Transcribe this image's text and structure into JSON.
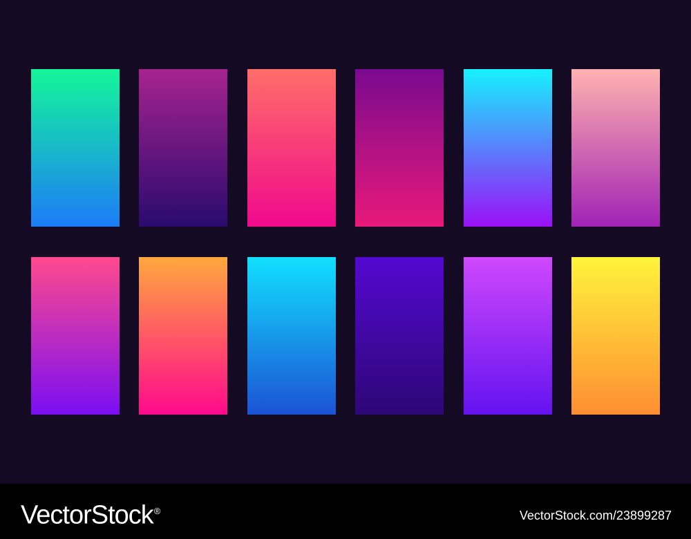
{
  "background_color": "#140a24",
  "swatches": [
    {
      "top": "#14f69a",
      "bottom": "#1c7cf7"
    },
    {
      "top": "#a6238f",
      "bottom": "#2a0a6e"
    },
    {
      "top": "#ff6e68",
      "bottom": "#f0098c"
    },
    {
      "top": "#7a0a8e",
      "bottom": "#e8197a"
    },
    {
      "top": "#16f2ff",
      "bottom": "#9b10f8"
    },
    {
      "top": "#ffb3b0",
      "bottom": "#a222b4"
    },
    {
      "top": "#ff4a8e",
      "bottom": "#7a0ef2"
    },
    {
      "top": "#ffa83e",
      "bottom": "#ff0a8c"
    },
    {
      "top": "#12e0fe",
      "bottom": "#1b52d4"
    },
    {
      "top": "#5408d0",
      "bottom": "#2e0776"
    },
    {
      "top": "#cf48fc",
      "bottom": "#6412f0"
    },
    {
      "top": "#fff43c",
      "bottom": "#ff8e32"
    }
  ],
  "footer": {
    "brand": "VectorStock",
    "registered_mark": "®",
    "image_id": "VectorStock.com/23899287"
  }
}
